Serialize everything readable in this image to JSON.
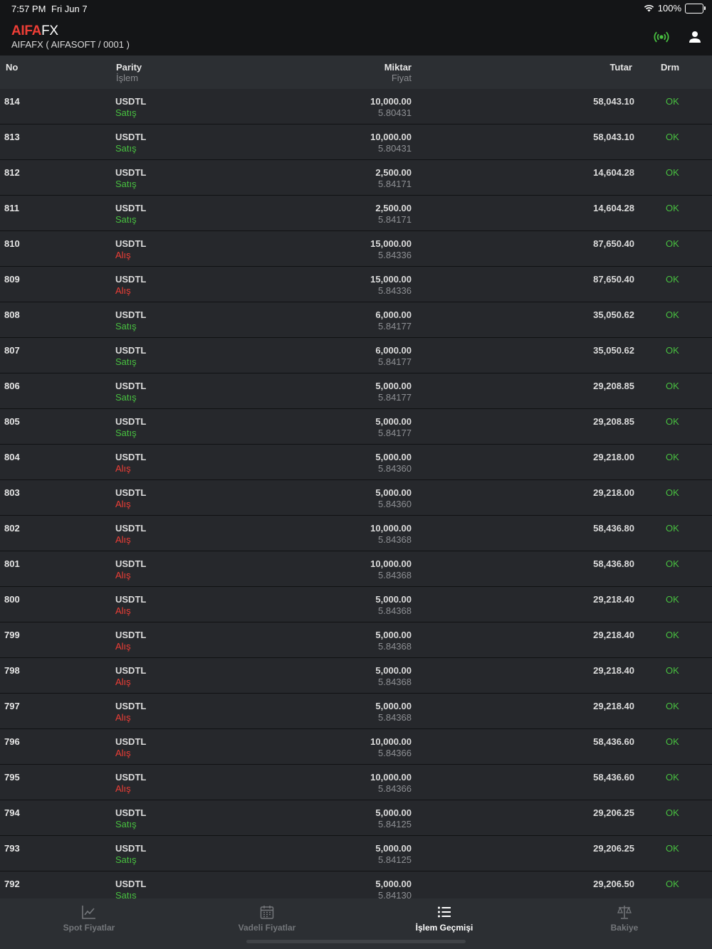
{
  "status_bar": {
    "time": "7:57 PM",
    "date": "Fri Jun 7",
    "battery": "100%"
  },
  "header": {
    "brand_red": "AIFA",
    "brand_white": "FX",
    "subtitle": "AIFAFX  ( AIFASOFT / 0001 )"
  },
  "columns": {
    "no": "No",
    "parity": "Parity",
    "islem": "İşlem",
    "miktar": "Miktar",
    "fiyat": "Fiyat",
    "tutar": "Tutar",
    "drm": "Drm"
  },
  "colors": {
    "accent_red": "#ef3e36",
    "ok_green": "#48c040"
  },
  "rows": [
    {
      "no": "814",
      "parity": "USDTL",
      "side": "Satış",
      "type": "sell",
      "amount": "10,000.00",
      "price": "5.80431",
      "total": "58,043.10",
      "status": "OK"
    },
    {
      "no": "813",
      "parity": "USDTL",
      "side": "Satış",
      "type": "sell",
      "amount": "10,000.00",
      "price": "5.80431",
      "total": "58,043.10",
      "status": "OK"
    },
    {
      "no": "812",
      "parity": "USDTL",
      "side": "Satış",
      "type": "sell",
      "amount": "2,500.00",
      "price": "5.84171",
      "total": "14,604.28",
      "status": "OK"
    },
    {
      "no": "811",
      "parity": "USDTL",
      "side": "Satış",
      "type": "sell",
      "amount": "2,500.00",
      "price": "5.84171",
      "total": "14,604.28",
      "status": "OK"
    },
    {
      "no": "810",
      "parity": "USDTL",
      "side": "Alış",
      "type": "buy",
      "amount": "15,000.00",
      "price": "5.84336",
      "total": "87,650.40",
      "status": "OK"
    },
    {
      "no": "809",
      "parity": "USDTL",
      "side": "Alış",
      "type": "buy",
      "amount": "15,000.00",
      "price": "5.84336",
      "total": "87,650.40",
      "status": "OK"
    },
    {
      "no": "808",
      "parity": "USDTL",
      "side": "Satış",
      "type": "sell",
      "amount": "6,000.00",
      "price": "5.84177",
      "total": "35,050.62",
      "status": "OK"
    },
    {
      "no": "807",
      "parity": "USDTL",
      "side": "Satış",
      "type": "sell",
      "amount": "6,000.00",
      "price": "5.84177",
      "total": "35,050.62",
      "status": "OK"
    },
    {
      "no": "806",
      "parity": "USDTL",
      "side": "Satış",
      "type": "sell",
      "amount": "5,000.00",
      "price": "5.84177",
      "total": "29,208.85",
      "status": "OK"
    },
    {
      "no": "805",
      "parity": "USDTL",
      "side": "Satış",
      "type": "sell",
      "amount": "5,000.00",
      "price": "5.84177",
      "total": "29,208.85",
      "status": "OK"
    },
    {
      "no": "804",
      "parity": "USDTL",
      "side": "Alış",
      "type": "buy",
      "amount": "5,000.00",
      "price": "5.84360",
      "total": "29,218.00",
      "status": "OK"
    },
    {
      "no": "803",
      "parity": "USDTL",
      "side": "Alış",
      "type": "buy",
      "amount": "5,000.00",
      "price": "5.84360",
      "total": "29,218.00",
      "status": "OK"
    },
    {
      "no": "802",
      "parity": "USDTL",
      "side": "Alış",
      "type": "buy",
      "amount": "10,000.00",
      "price": "5.84368",
      "total": "58,436.80",
      "status": "OK"
    },
    {
      "no": "801",
      "parity": "USDTL",
      "side": "Alış",
      "type": "buy",
      "amount": "10,000.00",
      "price": "5.84368",
      "total": "58,436.80",
      "status": "OK"
    },
    {
      "no": "800",
      "parity": "USDTL",
      "side": "Alış",
      "type": "buy",
      "amount": "5,000.00",
      "price": "5.84368",
      "total": "29,218.40",
      "status": "OK"
    },
    {
      "no": "799",
      "parity": "USDTL",
      "side": "Alış",
      "type": "buy",
      "amount": "5,000.00",
      "price": "5.84368",
      "total": "29,218.40",
      "status": "OK"
    },
    {
      "no": "798",
      "parity": "USDTL",
      "side": "Alış",
      "type": "buy",
      "amount": "5,000.00",
      "price": "5.84368",
      "total": "29,218.40",
      "status": "OK"
    },
    {
      "no": "797",
      "parity": "USDTL",
      "side": "Alış",
      "type": "buy",
      "amount": "5,000.00",
      "price": "5.84368",
      "total": "29,218.40",
      "status": "OK"
    },
    {
      "no": "796",
      "parity": "USDTL",
      "side": "Alış",
      "type": "buy",
      "amount": "10,000.00",
      "price": "5.84366",
      "total": "58,436.60",
      "status": "OK"
    },
    {
      "no": "795",
      "parity": "USDTL",
      "side": "Alış",
      "type": "buy",
      "amount": "10,000.00",
      "price": "5.84366",
      "total": "58,436.60",
      "status": "OK"
    },
    {
      "no": "794",
      "parity": "USDTL",
      "side": "Satış",
      "type": "sell",
      "amount": "5,000.00",
      "price": "5.84125",
      "total": "29,206.25",
      "status": "OK"
    },
    {
      "no": "793",
      "parity": "USDTL",
      "side": "Satış",
      "type": "sell",
      "amount": "5,000.00",
      "price": "5.84125",
      "total": "29,206.25",
      "status": "OK"
    },
    {
      "no": "792",
      "parity": "USDTL",
      "side": "Satış",
      "type": "sell",
      "amount": "5,000.00",
      "price": "5.84130",
      "total": "29,206.50",
      "status": "OK"
    }
  ],
  "tabs": [
    {
      "label": "Spot Fiyatlar",
      "icon": "line-chart-icon",
      "active": false
    },
    {
      "label": "Vadeli Fiyatlar",
      "icon": "calendar-icon",
      "active": false
    },
    {
      "label": "İşlem Geçmişi",
      "icon": "list-icon",
      "active": true
    },
    {
      "label": "Bakiye",
      "icon": "balance-scale-icon",
      "active": false
    }
  ]
}
